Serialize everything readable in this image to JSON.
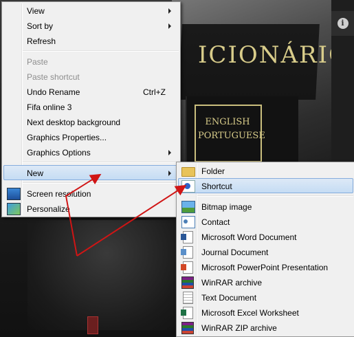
{
  "desktop": {
    "wallpaper_title": "ICIONÁRIO",
    "label_lines": [
      "ENGLISH",
      "PORTUGUESE"
    ]
  },
  "context_menu": {
    "items": [
      {
        "label": "View",
        "submenu": true
      },
      {
        "label": "Sort by",
        "submenu": true
      },
      {
        "label": "Refresh"
      },
      {
        "label": "Paste",
        "disabled": true
      },
      {
        "label": "Paste shortcut",
        "disabled": true
      },
      {
        "label": "Undo Rename",
        "shortcut": "Ctrl+Z"
      },
      {
        "label": "Fifa online 3"
      },
      {
        "label": "Next desktop background"
      },
      {
        "label": "Graphics Properties..."
      },
      {
        "label": "Graphics Options",
        "submenu": true
      },
      {
        "label": "New",
        "submenu": true,
        "highlighted": true
      },
      {
        "label": "Screen resolution",
        "icon": "monitor-icon"
      },
      {
        "label": "Personalize",
        "icon": "personalize-icon"
      }
    ]
  },
  "new_submenu": {
    "items": [
      {
        "label": "Folder",
        "icon": "folder-icon"
      },
      {
        "label": "Shortcut",
        "icon": "shortcut-icon",
        "highlighted": true
      },
      {
        "label": "Bitmap image",
        "icon": "bitmap-icon"
      },
      {
        "label": "Contact",
        "icon": "contact-icon"
      },
      {
        "label": "Microsoft Word Document",
        "icon": "word-icon"
      },
      {
        "label": "Journal Document",
        "icon": "journal-icon"
      },
      {
        "label": "Microsoft PowerPoint Presentation",
        "icon": "powerpoint-icon"
      },
      {
        "label": "WinRAR archive",
        "icon": "winrar-icon"
      },
      {
        "label": "Text Document",
        "icon": "text-document-icon"
      },
      {
        "label": "Microsoft Excel Worksheet",
        "icon": "excel-icon"
      },
      {
        "label": "WinRAR ZIP archive",
        "icon": "winrar-zip-icon"
      }
    ]
  },
  "colors": {
    "annotation_arrow": "#d01515",
    "highlight": "#c5dcf4"
  }
}
